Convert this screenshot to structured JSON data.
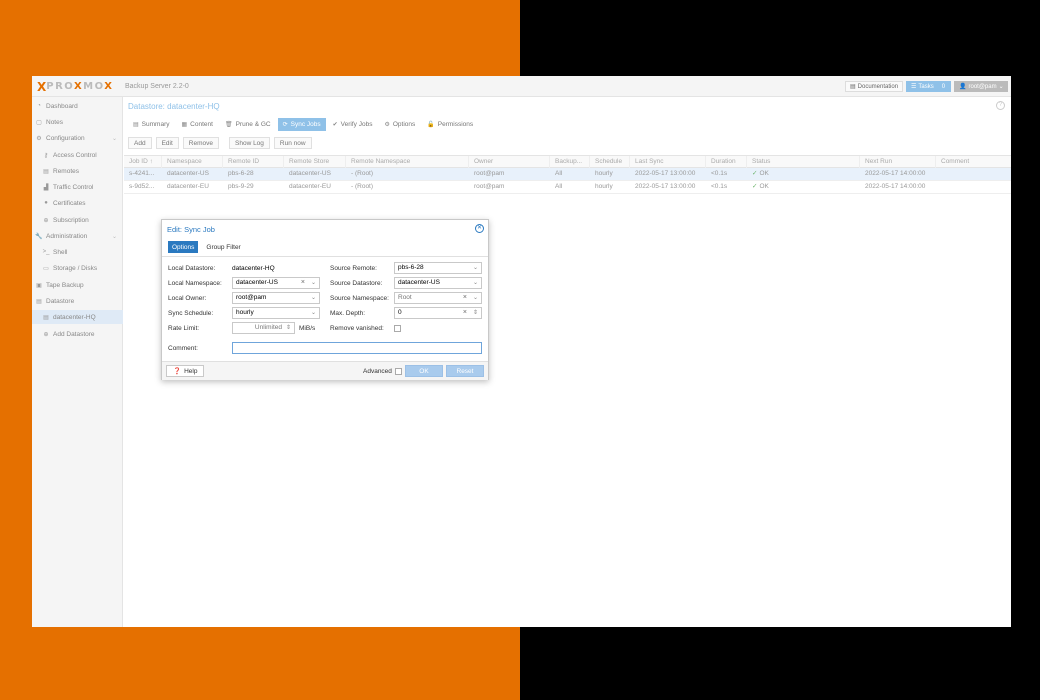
{
  "header": {
    "logo_x": "X",
    "logo_text_a": "PRO",
    "logo_text_x": "X",
    "logo_text_b": "MO",
    "logo_text_c": "X",
    "subtitle": "Backup Server 2.2-0",
    "documentation": "Documentation",
    "tasks": "Tasks",
    "tasks_count": "0",
    "user": "root@pam"
  },
  "sidebar": {
    "items": [
      {
        "label": "Dashboard",
        "icon": "dashboard-icon"
      },
      {
        "label": "Notes",
        "icon": "notes-icon"
      },
      {
        "label": "Configuration",
        "icon": "cogs-icon"
      },
      {
        "label": "Access Control",
        "icon": "key-icon"
      },
      {
        "label": "Remotes",
        "icon": "server-icon"
      },
      {
        "label": "Traffic Control",
        "icon": "chart-icon"
      },
      {
        "label": "Certificates",
        "icon": "certificate-icon"
      },
      {
        "label": "Subscription",
        "icon": "support-icon"
      },
      {
        "label": "Administration",
        "icon": "wrench-icon"
      },
      {
        "label": "Shell",
        "icon": "terminal-icon"
      },
      {
        "label": "Storage / Disks",
        "icon": "hdd-icon"
      },
      {
        "label": "Tape Backup",
        "icon": "tape-icon"
      },
      {
        "label": "Datastore",
        "icon": "database-icon"
      },
      {
        "label": "datacenter-HQ",
        "icon": "database-icon"
      },
      {
        "label": "Add Datastore",
        "icon": "plus-circle-icon"
      }
    ]
  },
  "main": {
    "title": "Datastore: datacenter-HQ",
    "tabs": [
      "Summary",
      "Content",
      "Prune & GC",
      "Sync Jobs",
      "Verify Jobs",
      "Options",
      "Permissions"
    ],
    "toolbar": [
      "Add",
      "Edit",
      "Remove",
      "Show Log",
      "Run now"
    ],
    "columns": [
      "Job ID ↑",
      "Namespace",
      "Remote ID",
      "Remote Store",
      "Remote Namespace",
      "Owner",
      "Backup...",
      "Schedule",
      "Last Sync",
      "Duration",
      "Status",
      "Next Run",
      "Comment"
    ],
    "rows": [
      [
        "s-4241...",
        "datacenter-US",
        "pbs-6-28",
        "datacenter-US",
        "- (Root)",
        "root@pam",
        "All",
        "hourly",
        "2022-05-17 13:00:00",
        "<0.1s",
        "OK",
        "2022-05-17 14:00:00",
        ""
      ],
      [
        "s-9d52...",
        "datacenter-EU",
        "pbs-9-29",
        "datacenter-EU",
        "- (Root)",
        "root@pam",
        "All",
        "hourly",
        "2022-05-17 13:00:00",
        "<0.1s",
        "OK",
        "2022-05-17 14:00:00",
        ""
      ]
    ]
  },
  "dialog": {
    "title": "Edit: Sync Job",
    "tabs": [
      "Options",
      "Group Filter"
    ],
    "local_datastore_label": "Local Datastore:",
    "local_datastore_value": "datacenter-HQ",
    "local_namespace_label": "Local Namespace:",
    "local_namespace_value": "datacenter-US",
    "local_owner_label": "Local Owner:",
    "local_owner_value": "root@pam",
    "sync_schedule_label": "Sync Schedule:",
    "sync_schedule_value": "hourly",
    "rate_limit_label": "Rate Limit:",
    "rate_limit_placeholder": "Unlimited",
    "rate_limit_unit": "MiB/s",
    "comment_label": "Comment:",
    "comment_value": "",
    "source_remote_label": "Source Remote:",
    "source_remote_value": "pbs-6-28",
    "source_datastore_label": "Source Datastore:",
    "source_datastore_value": "datacenter-US",
    "source_namespace_label": "Source Namespace:",
    "source_namespace_placeholder": "Root",
    "max_depth_label": "Max. Depth:",
    "max_depth_value": "0",
    "remove_vanished_label": "Remove vanished:",
    "help": "Help",
    "advanced": "Advanced",
    "ok": "OK",
    "reset": "Reset"
  },
  "colors": {
    "accent": "#e57000",
    "selection": "#8fc1e8",
    "dialog_blue": "#2a79c0"
  }
}
